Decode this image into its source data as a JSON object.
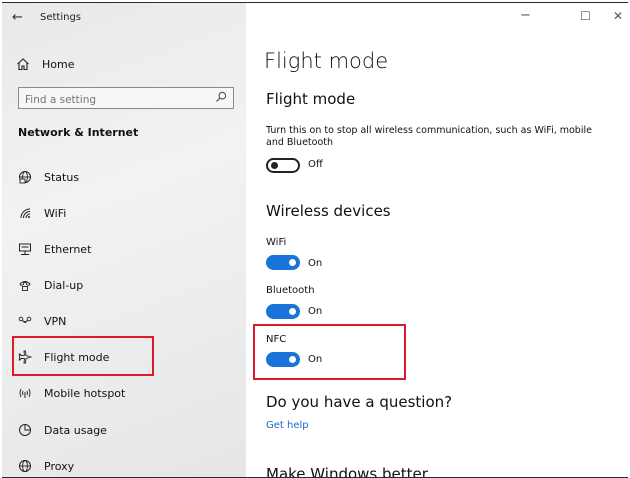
{
  "titlebar": {
    "title": "Settings",
    "back_glyph": "←",
    "minimize_glyph": "−",
    "maximize_glyph": "☐",
    "close_glyph": "✕"
  },
  "sidebar": {
    "home_label": "Home",
    "home_icon": "home-icon",
    "search_placeholder": "Find a setting",
    "section_header": "Network & Internet",
    "items": [
      {
        "label": "Status",
        "icon": "globe-status-icon"
      },
      {
        "label": "WiFi",
        "icon": "wifi-icon"
      },
      {
        "label": "Ethernet",
        "icon": "ethernet-icon"
      },
      {
        "label": "Dial-up",
        "icon": "dialup-icon"
      },
      {
        "label": "VPN",
        "icon": "vpn-icon"
      },
      {
        "label": "Flight mode",
        "icon": "airplane-icon"
      },
      {
        "label": "Mobile hotspot",
        "icon": "hotspot-icon"
      },
      {
        "label": "Data usage",
        "icon": "data-usage-icon"
      },
      {
        "label": "Proxy",
        "icon": "proxy-globe-icon"
      }
    ]
  },
  "main": {
    "page_title": "Flight mode",
    "flight_section_title": "Flight mode",
    "flight_description": "Turn this on to stop all wireless communication, such as WiFi, mobile and Bluetooth",
    "flight_toggle_state": "Off",
    "wireless_title": "Wireless devices",
    "wifi_label": "WiFi",
    "wifi_state": "On",
    "bluetooth_label": "Bluetooth",
    "bluetooth_state": "On",
    "nfc_label": "NFC",
    "nfc_state": "On",
    "question_title": "Do you have a question?",
    "get_help": "Get help",
    "make_better": "Make Windows better"
  },
  "colors": {
    "accent": "#1a73d9",
    "highlight": "#e0192a",
    "link": "#1a6ac5",
    "sidebar_bg": "#ececec"
  }
}
